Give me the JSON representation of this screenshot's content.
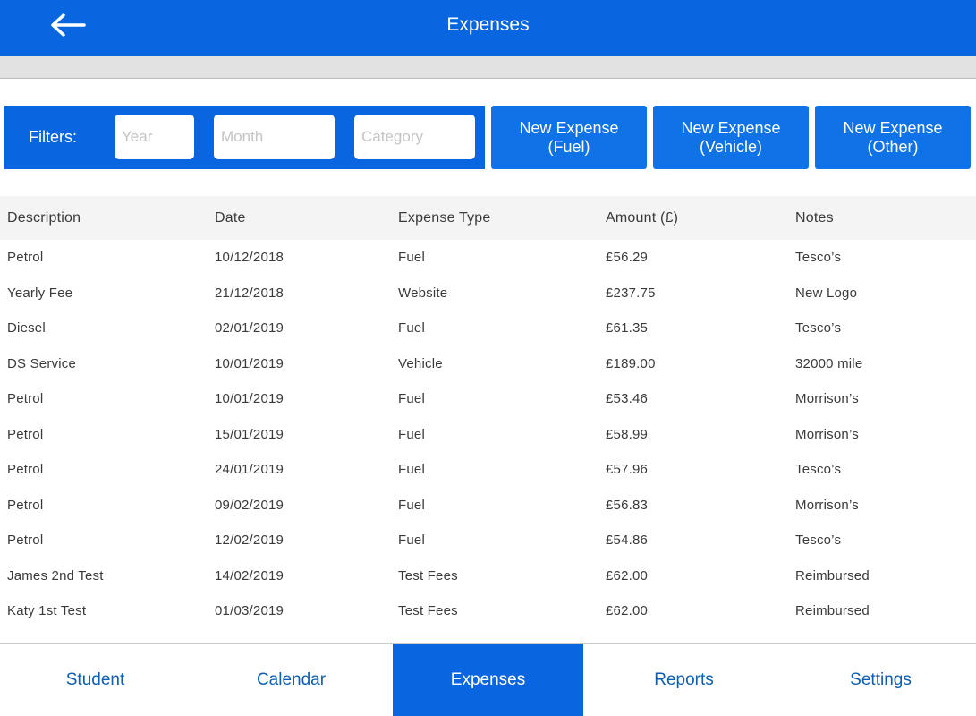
{
  "header": {
    "title": "Expenses",
    "back_icon": "back-arrow-icon"
  },
  "filters": {
    "label": "Filters:",
    "year_placeholder": "Year",
    "month_placeholder": "Month",
    "category_placeholder": "Category"
  },
  "actions": {
    "fuel": [
      "New Expense",
      "(Fuel)"
    ],
    "vehicle": [
      "New Expense",
      "(Vehicle)"
    ],
    "other": [
      "New Expense",
      "(Other)"
    ]
  },
  "table": {
    "columns": [
      "Description",
      "Date",
      "Expense Type",
      "Amount (£)",
      "Notes"
    ],
    "rows": [
      [
        "Petrol",
        "10/12/2018",
        "Fuel",
        "£56.29",
        "Tesco’s"
      ],
      [
        "Yearly Fee",
        "21/12/2018",
        "Website",
        "£237.75",
        "New Logo"
      ],
      [
        "Diesel",
        "02/01/2019",
        "Fuel",
        "£61.35",
        "Tesco’s"
      ],
      [
        "DS Service",
        "10/01/2019",
        "Vehicle",
        "£189.00",
        "32000 mile"
      ],
      [
        "Petrol",
        "10/01/2019",
        "Fuel",
        "£53.46",
        "Morrison’s"
      ],
      [
        "Petrol",
        "15/01/2019",
        "Fuel",
        "£58.99",
        "Morrison’s"
      ],
      [
        "Petrol",
        "24/01/2019",
        "Fuel",
        "£57.96",
        "Tesco’s"
      ],
      [
        "Petrol",
        "09/02/2019",
        "Fuel",
        "£56.83",
        "Morrison’s"
      ],
      [
        "Petrol",
        "12/02/2019",
        "Fuel",
        "£54.86",
        "Tesco’s"
      ],
      [
        "James 2nd Test",
        "14/02/2019",
        "Test Fees",
        "£62.00",
        "Reimbursed"
      ],
      [
        "Katy 1st Test",
        "01/03/2019",
        "Test Fees",
        "£62.00",
        "Reimbursed"
      ]
    ]
  },
  "tabs": [
    {
      "label": "Student",
      "active": false
    },
    {
      "label": "Calendar",
      "active": false
    },
    {
      "label": "Expenses",
      "active": true
    },
    {
      "label": "Reports",
      "active": false
    },
    {
      "label": "Settings",
      "active": false
    }
  ],
  "colors": {
    "brand_blue": "#0a66e0",
    "button_blue": "#0f72e6",
    "tab_text": "#0e5eb4"
  }
}
